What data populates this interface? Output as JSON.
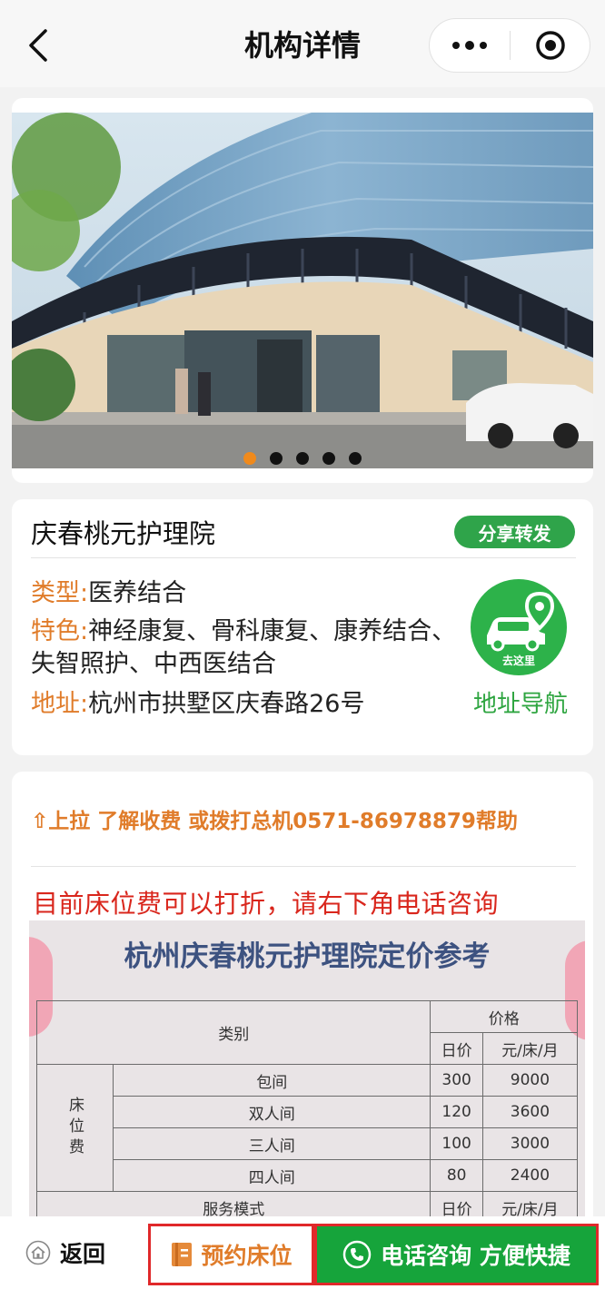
{
  "header": {
    "title": "机构详情"
  },
  "banner": {
    "slide_count": 5,
    "active_slide": 1
  },
  "info": {
    "name": "庆春桃元护理院",
    "share_label": "分享转发",
    "type_label": "类型:",
    "type_value": "医养结合",
    "feature_label": "特色:",
    "feature_value": "神经康复、骨科康复、康养结合、失智照护、中西医结合",
    "address_label": "地址:",
    "address_value": "杭州市拱墅区庆春路26号",
    "nav_badge": "去这里",
    "nav_label": "地址导航"
  },
  "fee": {
    "tip": "⇧上拉 了解收费 或拨打总机0571-86978879帮助",
    "discount": "目前床位费可以打折，请右下角电话咨询",
    "photo": {
      "title": "杭州庆春桃元护理院定价参考",
      "category_header": "类别",
      "price_header": "价格",
      "daily_header": "日价",
      "monthly_header": "元/床/月",
      "bed_fee_label": "床位费",
      "rows": [
        {
          "name": "包间",
          "daily": "300",
          "monthly": "9000"
        },
        {
          "name": "双人间",
          "daily": "120",
          "monthly": "3600"
        },
        {
          "name": "三人间",
          "daily": "100",
          "monthly": "3000"
        },
        {
          "name": "四人间",
          "daily": "80",
          "monthly": "2400"
        }
      ],
      "service_label": "服务模式",
      "service_daily": "日价",
      "service_monthly": "元/床/月"
    }
  },
  "bottom_bar": {
    "back_label": "返回",
    "reserve_label": "预约床位",
    "call_label": "电话咨询 方便快捷"
  },
  "colors": {
    "accent_green": "#2fa44a",
    "accent_orange": "#e07c2a",
    "alert_red": "#d9261c",
    "highlight_border": "#e0282a"
  }
}
